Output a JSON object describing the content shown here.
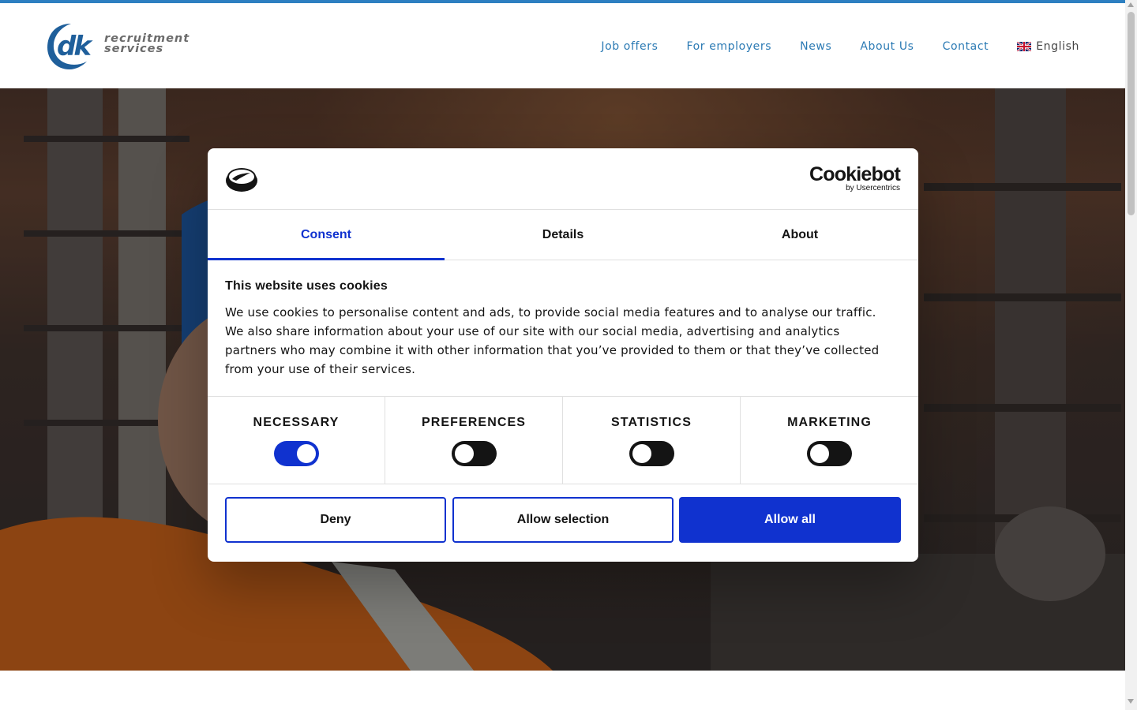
{
  "header": {
    "logo": {
      "brand": "dk",
      "line1": "recruitment",
      "line2": "services"
    },
    "nav": [
      {
        "label": "Job offers"
      },
      {
        "label": "For employers"
      },
      {
        "label": "News"
      },
      {
        "label": "About Us"
      },
      {
        "label": "Contact"
      }
    ],
    "language": {
      "label": "English",
      "flag_icon": "uk-flag-icon"
    }
  },
  "colors": {
    "accent": "#2d7fc1",
    "nav_link": "#2b7ab4",
    "consent_primary": "#1032cf",
    "text_dark": "#141414"
  },
  "cookie_dialog": {
    "brand": "Cookiebot",
    "brand_sub": "by Usercentrics",
    "tabs": [
      {
        "label": "Consent",
        "active": true
      },
      {
        "label": "Details",
        "active": false
      },
      {
        "label": "About",
        "active": false
      }
    ],
    "title": "This website uses cookies",
    "description": "We use cookies to personalise content and ads, to provide social media features and to analyse our traffic. We also share information about your use of our site with our social media, advertising and analytics partners who may combine it with other information that you’ve provided to them or that they’ve collected from your use of their services.",
    "categories": [
      {
        "label": "NECESSARY",
        "enabled": true
      },
      {
        "label": "PREFERENCES",
        "enabled": false
      },
      {
        "label": "STATISTICS",
        "enabled": false
      },
      {
        "label": "MARKETING",
        "enabled": false
      }
    ],
    "buttons": {
      "deny": "Deny",
      "allow_selection": "Allow selection",
      "allow_all": "Allow all"
    }
  }
}
